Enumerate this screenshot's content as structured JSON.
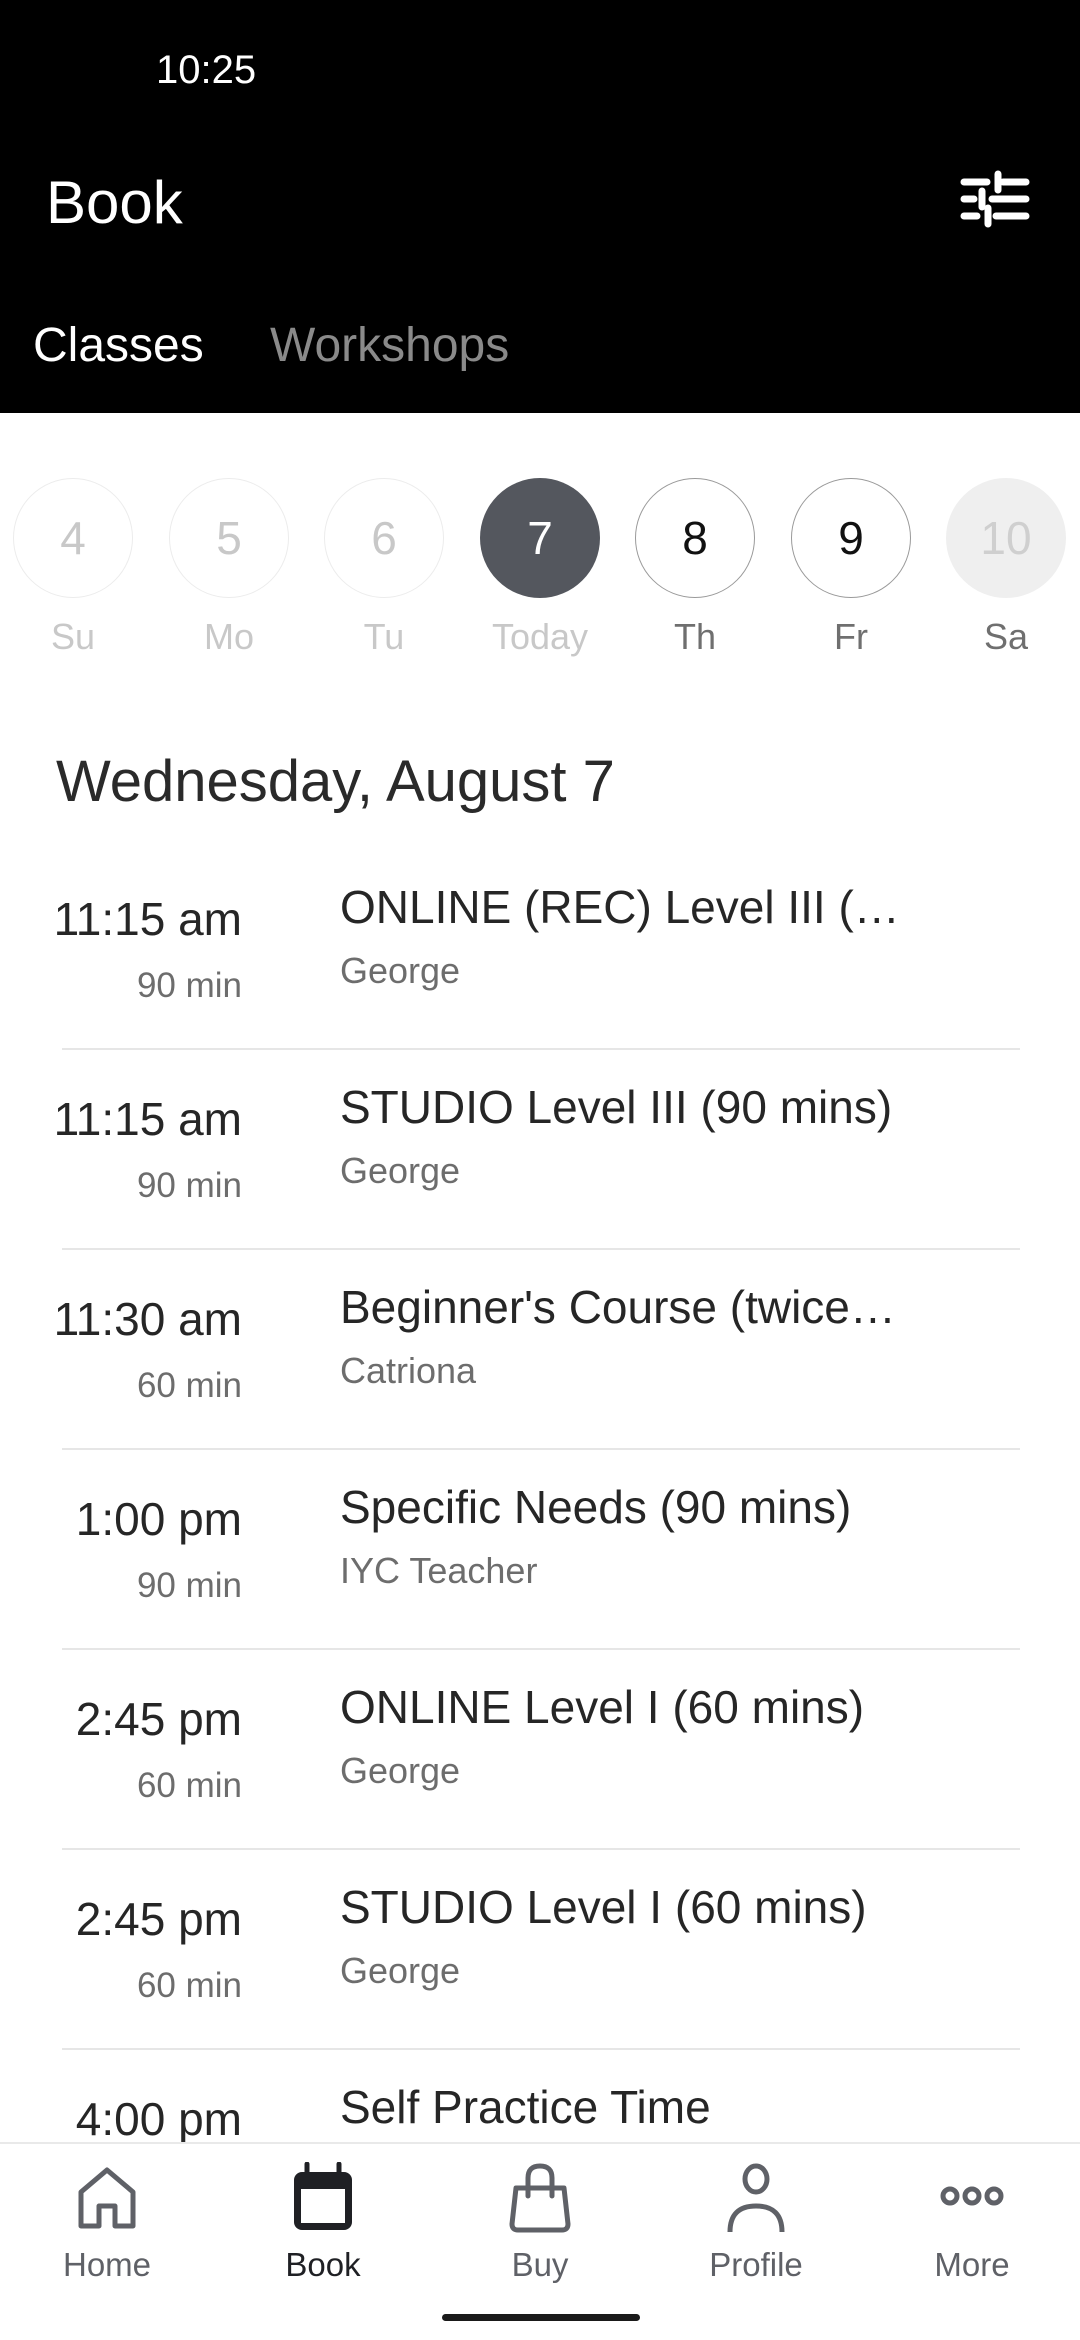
{
  "status_bar": {
    "time": "10:25"
  },
  "header": {
    "title": "Book",
    "filter_icon": "sliders-icon",
    "tabs": [
      {
        "label": "Classes",
        "active": true
      },
      {
        "label": "Workshops",
        "active": false
      }
    ]
  },
  "days": [
    {
      "number": "4",
      "label": "Su",
      "state": "past"
    },
    {
      "number": "5",
      "label": "Mo",
      "state": "past"
    },
    {
      "number": "6",
      "label": "Tu",
      "state": "past"
    },
    {
      "number": "7",
      "label": "Today",
      "state": "today"
    },
    {
      "number": "8",
      "label": "Th",
      "state": "future"
    },
    {
      "number": "9",
      "label": "Fr",
      "state": "future"
    },
    {
      "number": "10",
      "label": "Sa",
      "state": "disabled"
    }
  ],
  "date_heading": "Wednesday, August 7",
  "classes": [
    {
      "time": "11:15 am",
      "duration": "90 min",
      "name": "ONLINE (REC) Level III (…",
      "teacher": "George"
    },
    {
      "time": "11:15 am",
      "duration": "90 min",
      "name": "STUDIO Level III (90 mins)",
      "teacher": "George"
    },
    {
      "time": "11:30 am",
      "duration": "60 min",
      "name": "Beginner's Course (twice…",
      "teacher": "Catriona"
    },
    {
      "time": "1:00 pm",
      "duration": "90 min",
      "name": "Specific Needs (90 mins)",
      "teacher": "IYC Teacher"
    },
    {
      "time": "2:45 pm",
      "duration": "60 min",
      "name": "ONLINE Level I (60 mins)",
      "teacher": "George"
    },
    {
      "time": "2:45 pm",
      "duration": "60 min",
      "name": "STUDIO Level I (60 mins)",
      "teacher": "George"
    },
    {
      "time": "4:00 pm",
      "duration": "",
      "name": "Self Practice Time",
      "teacher": ""
    }
  ],
  "bottom_nav": [
    {
      "label": "Home",
      "icon": "home-icon",
      "active": false
    },
    {
      "label": "Book",
      "icon": "calendar-icon",
      "active": true
    },
    {
      "label": "Buy",
      "icon": "shopping-bag-icon",
      "active": false
    },
    {
      "label": "Profile",
      "icon": "person-icon",
      "active": false
    },
    {
      "label": "More",
      "icon": "more-dots-icon",
      "active": false
    }
  ],
  "colors": {
    "header_bg": "#000000",
    "today_circle": "#54575e",
    "active_nav": "#1f2024",
    "inactive_nav": "#5f6167"
  }
}
